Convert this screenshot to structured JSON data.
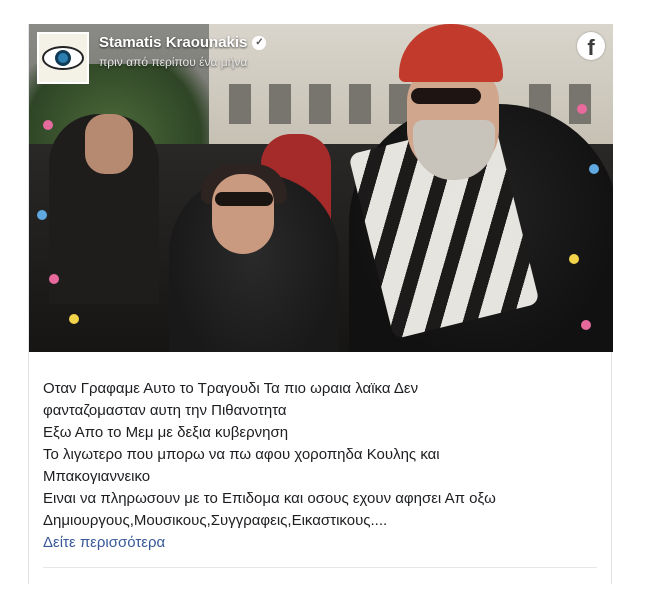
{
  "post": {
    "author": "Stamatis Kraounakis",
    "timestamp": "πριν από περίπου ένα μήνα",
    "verified_icon": "verified-check-icon",
    "platform_icon": "facebook-icon",
    "body_lines": [
      "Οταν Γραφαμε Αυτο το Τραγουδι Τα πιο ωραια λαϊκα Δεν",
      "φανταζομασταν αυτη την Πιθανοτητα",
      "Εξω Απο το Μεμ με δεξια κυβερνηση",
      "Το λιγωτερο που μπορω να πω αφου χοροπηδα Κουλης και",
      "Μπακογιαννεικο",
      "Ειναι να πληρωσουν με το Επιδομα και οσους εχουν αφησει Απ οξω",
      "Δημιουργους,Μουσικους,Συγγραφεις,Εικαστικους...."
    ],
    "see_more": "Δείτε περισσότερα"
  },
  "colors": {
    "link": "#385898",
    "text": "#1c1e21",
    "divider": "#e5e6ea"
  }
}
